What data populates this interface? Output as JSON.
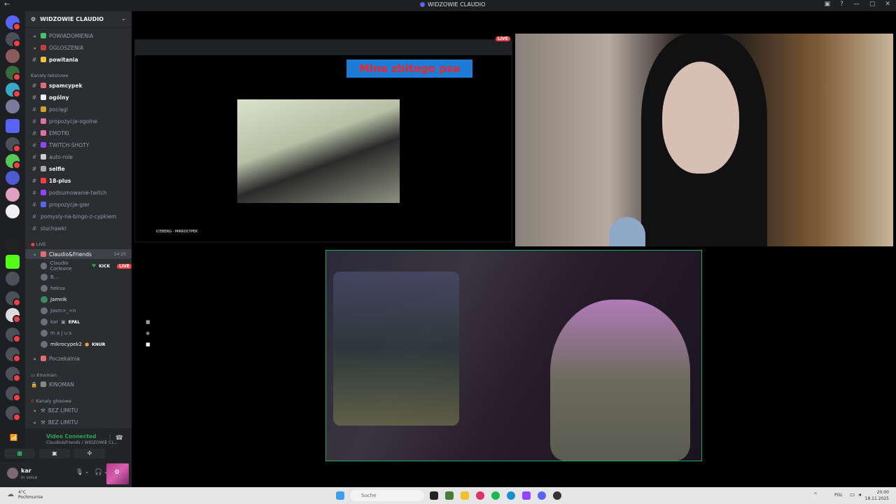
{
  "window": {
    "title": "WIDZOWIE CLAUDIO"
  },
  "guild": {
    "name": "WIDZOWIE CLAUDIO"
  },
  "channels": [
    {
      "name": "POWIADOMIENIA",
      "type": "text",
      "unread": false
    },
    {
      "name": "OGLOSZENIA",
      "type": "text",
      "unread": false
    },
    {
      "name": "powitania",
      "type": "text",
      "unread": true
    },
    {
      "name": "spamcypek",
      "type": "text",
      "unread": true
    },
    {
      "name": "ogólny",
      "type": "text",
      "unread": true
    },
    {
      "name": "pociągi",
      "type": "text",
      "unread": false
    },
    {
      "name": "propozycje-ogolne",
      "type": "text",
      "unread": false
    },
    {
      "name": "EMOTKI",
      "type": "text",
      "unread": false
    },
    {
      "name": "TWITCH-SHOTY",
      "type": "text",
      "unread": false
    },
    {
      "name": "auto-role",
      "type": "text",
      "unread": false
    },
    {
      "name": "selfie",
      "type": "text",
      "unread": true
    },
    {
      "name": "18-plus",
      "type": "text",
      "unread": true
    },
    {
      "name": "podsumowanie-twitch",
      "type": "text",
      "unread": false
    },
    {
      "name": "propozycje-gier",
      "type": "text",
      "unread": false
    },
    {
      "name": "pomysly-na-bingo-z-cypkiem",
      "type": "text",
      "unread": false
    },
    {
      "name": "sluchawki",
      "type": "text",
      "unread": false
    }
  ],
  "categories": {
    "text": "Kanały tekstowe",
    "live": "LIVE",
    "kinoman": "Kinoman",
    "voice": "Kanały głosowe"
  },
  "voice_channel": {
    "name": "Claudio&Friends",
    "timer": "54:25"
  },
  "voice_users": [
    {
      "name": "Claudio Corleone",
      "tag": "KICK",
      "live": "LIVE"
    },
    {
      "name": "B...",
      "tag": "",
      "live": ""
    },
    {
      "name": "heksa",
      "tag": "",
      "live": ""
    },
    {
      "name": "Jamnik",
      "tag": "",
      "live": ""
    },
    {
      "name": "Jasm>_<n",
      "tag": "",
      "live": ""
    },
    {
      "name": "kar",
      "tag": "EPAL",
      "live": ""
    },
    {
      "name": "m a j u s",
      "tag": "",
      "live": ""
    },
    {
      "name": "mikrocypek2",
      "tag": "KNUR",
      "live": ""
    }
  ],
  "other_voice": [
    {
      "name": "Poczekalnia"
    },
    {
      "name": "KINOMAN"
    },
    {
      "name": "BEZ LIMITU"
    },
    {
      "name": "BEZ LIMITU"
    }
  ],
  "voice_status": {
    "label": "Video Connected",
    "sub": "Claudio&Friends / WIDZOWIE CL..."
  },
  "user": {
    "name": "kar",
    "status": "In voice"
  },
  "stream": {
    "live_label": "LIVE",
    "overlay_title": "Mina zbitego psa",
    "video_title": "ICEBERG - MIKROCYPEK"
  },
  "taskbar": {
    "weather_temp": "4°C",
    "weather_desc": "Pochmurnie",
    "search": "Suche",
    "lang": "POL",
    "time": "20:00",
    "date": "18.11.2025"
  },
  "colors": {
    "accent": "#5865f2",
    "live": "#f23f43",
    "connected": "#23a55a"
  }
}
